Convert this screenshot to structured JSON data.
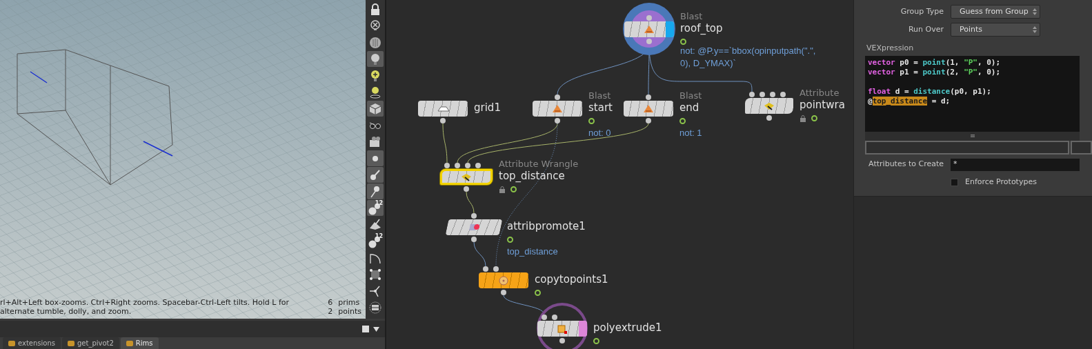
{
  "viewport": {
    "hint": "rl+Alt+Left box-zooms. Ctrl+Right zooms. Spacebar-Ctrl-Left tilts. Hold L for alternate tumble, dolly, and zoom.",
    "stats": [
      {
        "count": "6",
        "label": "prims"
      },
      {
        "count": "2",
        "label": "points"
      }
    ]
  },
  "toolbar": [
    {
      "kind": "lock",
      "selected": false
    },
    {
      "kind": "bulb_x",
      "selected": false
    },
    {
      "kind": "sphere",
      "selected": false
    },
    {
      "kind": "bulb",
      "selected": true
    },
    {
      "kind": "bulb_plus",
      "selected": false
    },
    {
      "kind": "bulb_pin",
      "selected": false
    },
    {
      "kind": "cube",
      "selected": true
    },
    {
      "kind": "glasses",
      "selected": false
    },
    {
      "kind": "camera",
      "selected": false
    },
    {
      "kind": "dot",
      "selected": true
    },
    {
      "kind": "brush",
      "selected": true
    },
    {
      "kind": "pin",
      "selected": true
    },
    {
      "kind": "points",
      "selected": true,
      "label": "12"
    },
    {
      "kind": "wedge",
      "selected": false
    },
    {
      "kind": "points",
      "selected": false,
      "label": "12"
    },
    {
      "kind": "curve",
      "selected": false
    },
    {
      "kind": "square",
      "selected": false
    },
    {
      "kind": "axes",
      "selected": false
    },
    {
      "kind": "disc",
      "selected": false
    }
  ],
  "tabs": [
    {
      "label": "extensions",
      "selected": false
    },
    {
      "label": "get_pivot2",
      "selected": false
    },
    {
      "label": "Rims",
      "selected": true
    }
  ],
  "network": {
    "nodes": [
      {
        "kind": "blast",
        "type": "Blast",
        "name": "roof_top",
        "comment": "not: @P.y==`bbox(opinputpath(\".\", 0), D_YMAX)`",
        "selected": false,
        "display_flag": true,
        "template_flag": false,
        "locked": false,
        "time_dependent": true
      },
      {
        "kind": "grid",
        "name": "grid1",
        "selected": false,
        "display_flag": false,
        "template_flag": false,
        "locked": false,
        "time_dependent": false
      },
      {
        "kind": "blast",
        "type": "Blast",
        "name": "start",
        "comment": "not: 0",
        "selected": false,
        "display_flag": false,
        "template_flag": false,
        "locked": false,
        "time_dependent": true
      },
      {
        "kind": "blast",
        "type": "Blast",
        "name": "end",
        "comment": "not: 1",
        "selected": false,
        "display_flag": false,
        "template_flag": false,
        "locked": false,
        "time_dependent": true
      },
      {
        "kind": "wrangle",
        "type": "Attribute",
        "name": "pointwra",
        "selected": false,
        "display_flag": false,
        "template_flag": false,
        "locked": true,
        "time_dependent": true
      },
      {
        "kind": "wrangle",
        "type": "Attribute Wrangle",
        "name": "top_distance",
        "selected": true,
        "display_flag": false,
        "template_flag": false,
        "locked": true,
        "time_dependent": true
      },
      {
        "kind": "promote",
        "name": "attribpromote1",
        "comment": "top_distance",
        "selected": false,
        "display_flag": false,
        "template_flag": false,
        "locked": false,
        "time_dependent": true
      },
      {
        "kind": "copy",
        "name": "copytopoints1",
        "color": "#f6a317",
        "selected": false,
        "display_flag": false,
        "template_flag": false,
        "locked": false,
        "time_dependent": true
      },
      {
        "kind": "extrude",
        "name": "polyextrude1",
        "selected": false,
        "display_flag": false,
        "template_flag": true,
        "locked": false,
        "time_dependent": true
      }
    ]
  },
  "parameters": {
    "group_type": {
      "label": "Group Type",
      "value": "Guess from Group"
    },
    "run_over": {
      "label": "Run Over",
      "value": "Points"
    },
    "vex_label": "VEXpression",
    "code": [
      {
        "blank_before": false,
        "tokens": [
          {
            "kind": "keyword",
            "text": "vector"
          },
          {
            "kind": "plain",
            "text": " p0 = "
          },
          {
            "kind": "function",
            "text": "point"
          },
          {
            "kind": "plain",
            "text": "(1, "
          },
          {
            "kind": "string",
            "text": "\"P\""
          },
          {
            "kind": "plain",
            "text": ", 0);"
          }
        ]
      },
      {
        "blank_before": false,
        "tokens": [
          {
            "kind": "keyword",
            "text": "vector"
          },
          {
            "kind": "plain",
            "text": " p1 = "
          },
          {
            "kind": "function",
            "text": "point"
          },
          {
            "kind": "plain",
            "text": "(2, "
          },
          {
            "kind": "string",
            "text": "\"P\""
          },
          {
            "kind": "plain",
            "text": ", 0);"
          }
        ]
      },
      {
        "blank_before": true,
        "tokens": [
          {
            "kind": "keyword",
            "text": "float"
          },
          {
            "kind": "plain",
            "text": " d = "
          },
          {
            "kind": "function",
            "text": "distance"
          },
          {
            "kind": "plain",
            "text": "(p0, p1);"
          }
        ]
      },
      {
        "blank_before": false,
        "tokens": [
          {
            "kind": "plain",
            "text": "@"
          },
          {
            "kind": "highlight",
            "text": "top_distance"
          },
          {
            "kind": "plain",
            "text": " = d;"
          }
        ]
      }
    ],
    "attributes": {
      "label": "Attributes to Create",
      "value": "*"
    },
    "enforce": {
      "label": "Enforce Prototypes",
      "checked": false
    }
  }
}
